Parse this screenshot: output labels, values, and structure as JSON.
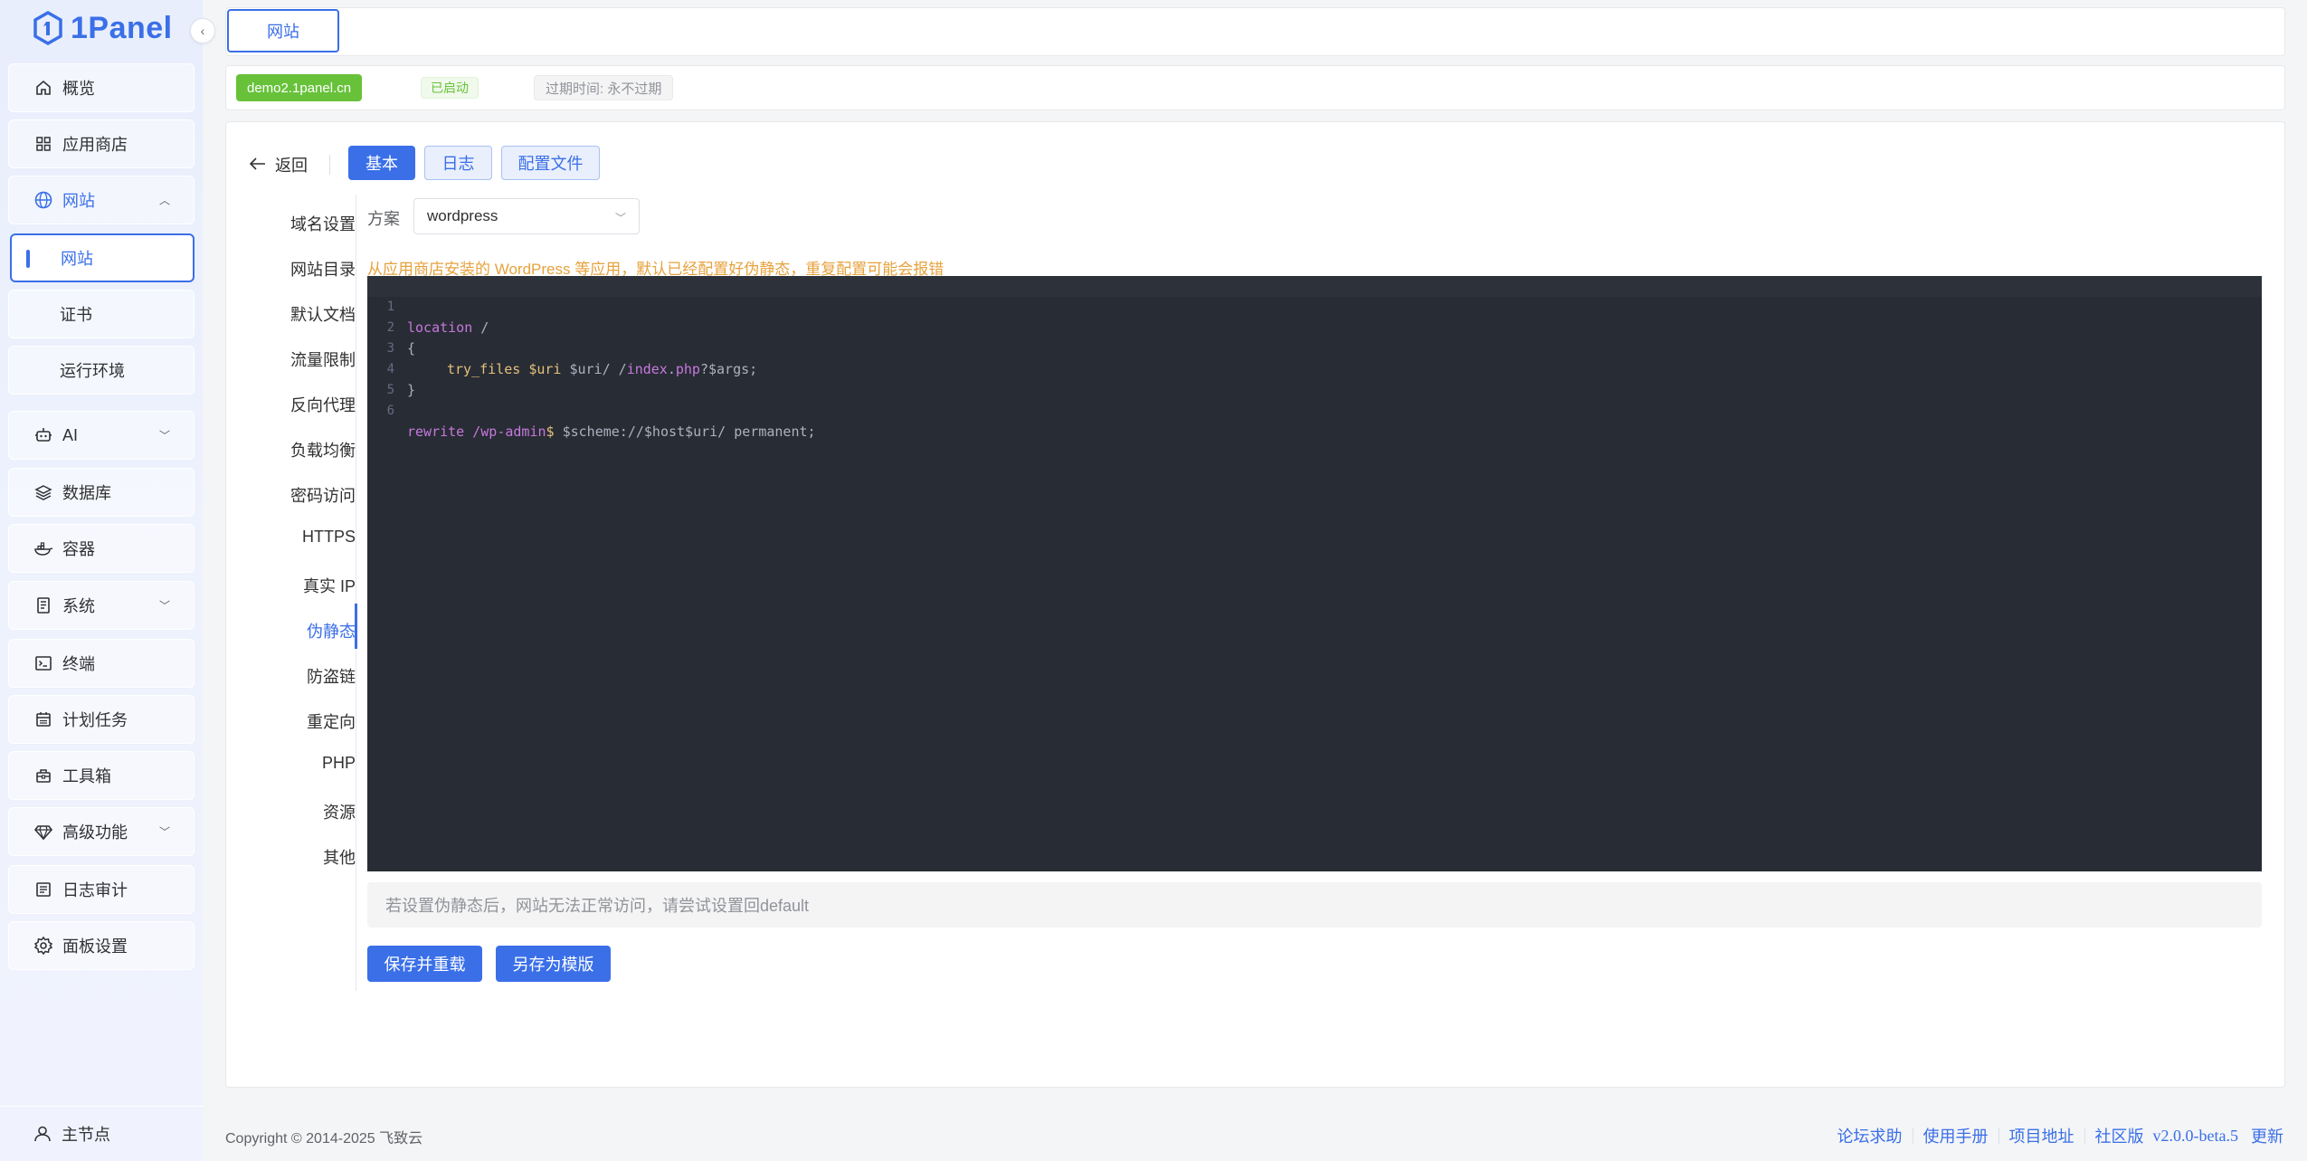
{
  "app": {
    "name": "1Panel"
  },
  "sidebar": {
    "items": [
      {
        "label": "概览",
        "icon": "home-icon"
      },
      {
        "label": "应用商店",
        "icon": "grid-icon"
      },
      {
        "label": "网站",
        "icon": "globe-icon"
      },
      {
        "label": "网站"
      },
      {
        "label": "证书"
      },
      {
        "label": "运行环境"
      },
      {
        "label": "AI",
        "icon": "robot-icon"
      },
      {
        "label": "数据库",
        "icon": "layers-icon"
      },
      {
        "label": "容器",
        "icon": "docker-icon"
      },
      {
        "label": "系统",
        "icon": "server-icon"
      },
      {
        "label": "终端",
        "icon": "terminal-icon"
      },
      {
        "label": "计划任务",
        "icon": "calendar-icon"
      },
      {
        "label": "工具箱",
        "icon": "toolbox-icon"
      },
      {
        "label": "高级功能",
        "icon": "diamond-icon"
      },
      {
        "label": "日志审计",
        "icon": "log-icon"
      },
      {
        "label": "面板设置",
        "icon": "gear-icon"
      }
    ],
    "footer": "主节点"
  },
  "top_tab": "网站",
  "site": {
    "domain": "demo2.1panel.cn",
    "status": "已启动",
    "expire": "过期时间: 永不过期"
  },
  "header": {
    "back": "返回",
    "tabs": [
      "基本",
      "日志",
      "配置文件"
    ]
  },
  "subnav": [
    "域名设置",
    "网站目录",
    "默认文档",
    "流量限制",
    "反向代理",
    "负载均衡",
    "密码访问",
    "HTTPS",
    "真实 IP",
    "伪静态",
    "防盗链",
    "重定向",
    "PHP",
    "资源",
    "其他"
  ],
  "rewrite": {
    "scheme_label": "方案",
    "scheme_value": "wordpress",
    "warning": "从应用商店安装的 WordPress 等应用，默认已经配置好伪静态，重复配置可能会报错",
    "line_numbers": [
      "1",
      "2",
      "3",
      "4",
      "5",
      "6"
    ],
    "code": {
      "l1_kw": "location",
      "l1_rest": " /",
      "l2": "{",
      "l3_fn": "try_files",
      "l3_var": "$uri",
      "l3_a": " $uri/ /",
      "l3_path": "index",
      "l3_b": ".",
      "l3_php": "php",
      "l3_c": "?$args;",
      "l4": "}",
      "l6_kw": "rewrite",
      "l6_path": "/wp-admin",
      "l6_dollar": "$",
      "l6_rest": " $scheme://$host$uri/ permanent;"
    },
    "hint": "若设置伪静态后，网站无法正常访问，请尝试设置回default",
    "save_button": "保存并重载",
    "template_button": "另存为模版"
  },
  "footer": {
    "copyright": "Copyright © 2014-2025 飞致云",
    "links": [
      "论坛求助",
      "使用手册",
      "项目地址",
      "社区版"
    ],
    "version": "v2.0.0-beta.5",
    "update": "更新"
  },
  "colors": {
    "accent": "#3a6fe8",
    "success": "#67c23a",
    "warning": "#e6a23c",
    "editor_bg": "#282c34"
  }
}
